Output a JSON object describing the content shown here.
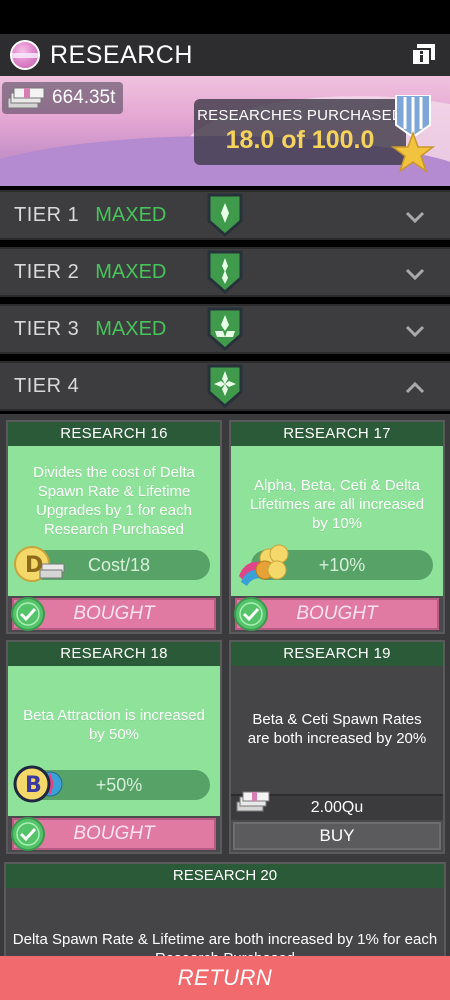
{
  "header": {
    "title": "RESEARCH"
  },
  "banner": {
    "money": "664.35t",
    "purchased_label": "RESEARCHES PURCHASED",
    "purchased_value": "18.0 of 100.0"
  },
  "tiers": [
    {
      "label": "TIER 1",
      "status": "MAXED",
      "expanded": false
    },
    {
      "label": "TIER 2",
      "status": "MAXED",
      "expanded": false
    },
    {
      "label": "TIER 3",
      "status": "MAXED",
      "expanded": false
    },
    {
      "label": "TIER 4",
      "status": "",
      "expanded": true
    }
  ],
  "research": [
    {
      "title": "RESEARCH 16",
      "desc": "Divides the cost of Delta Spawn Rate & Lifetime Upgrades by 1 for each Research Purchased",
      "effect": "Cost/18",
      "state": "BOUGHT"
    },
    {
      "title": "RESEARCH 17",
      "desc": "Alpha, Beta, Ceti & Delta Lifetimes are all increased by 10%",
      "effect": "+10%",
      "state": "BOUGHT"
    },
    {
      "title": "RESEARCH 18",
      "desc": "Beta Attraction is increased by 50%",
      "effect": "+50%",
      "state": "BOUGHT"
    },
    {
      "title": "RESEARCH 19",
      "desc": "Beta & Ceti Spawn Rates are both increased by 20%",
      "price": "2.00Qu",
      "buy_label": "BUY"
    },
    {
      "title": "RESEARCH 20",
      "desc": "Delta Spawn Rate & Lifetime are both increased by 1% for each Research Purchased"
    }
  ],
  "footer": {
    "return_label": "RETURN"
  },
  "colors": {
    "accent_green": "#8ee29a",
    "maxed_green": "#47c45a",
    "bought_pink": "#e07aa3",
    "return_red": "#f06a6e",
    "gold": "#f5d35c"
  }
}
